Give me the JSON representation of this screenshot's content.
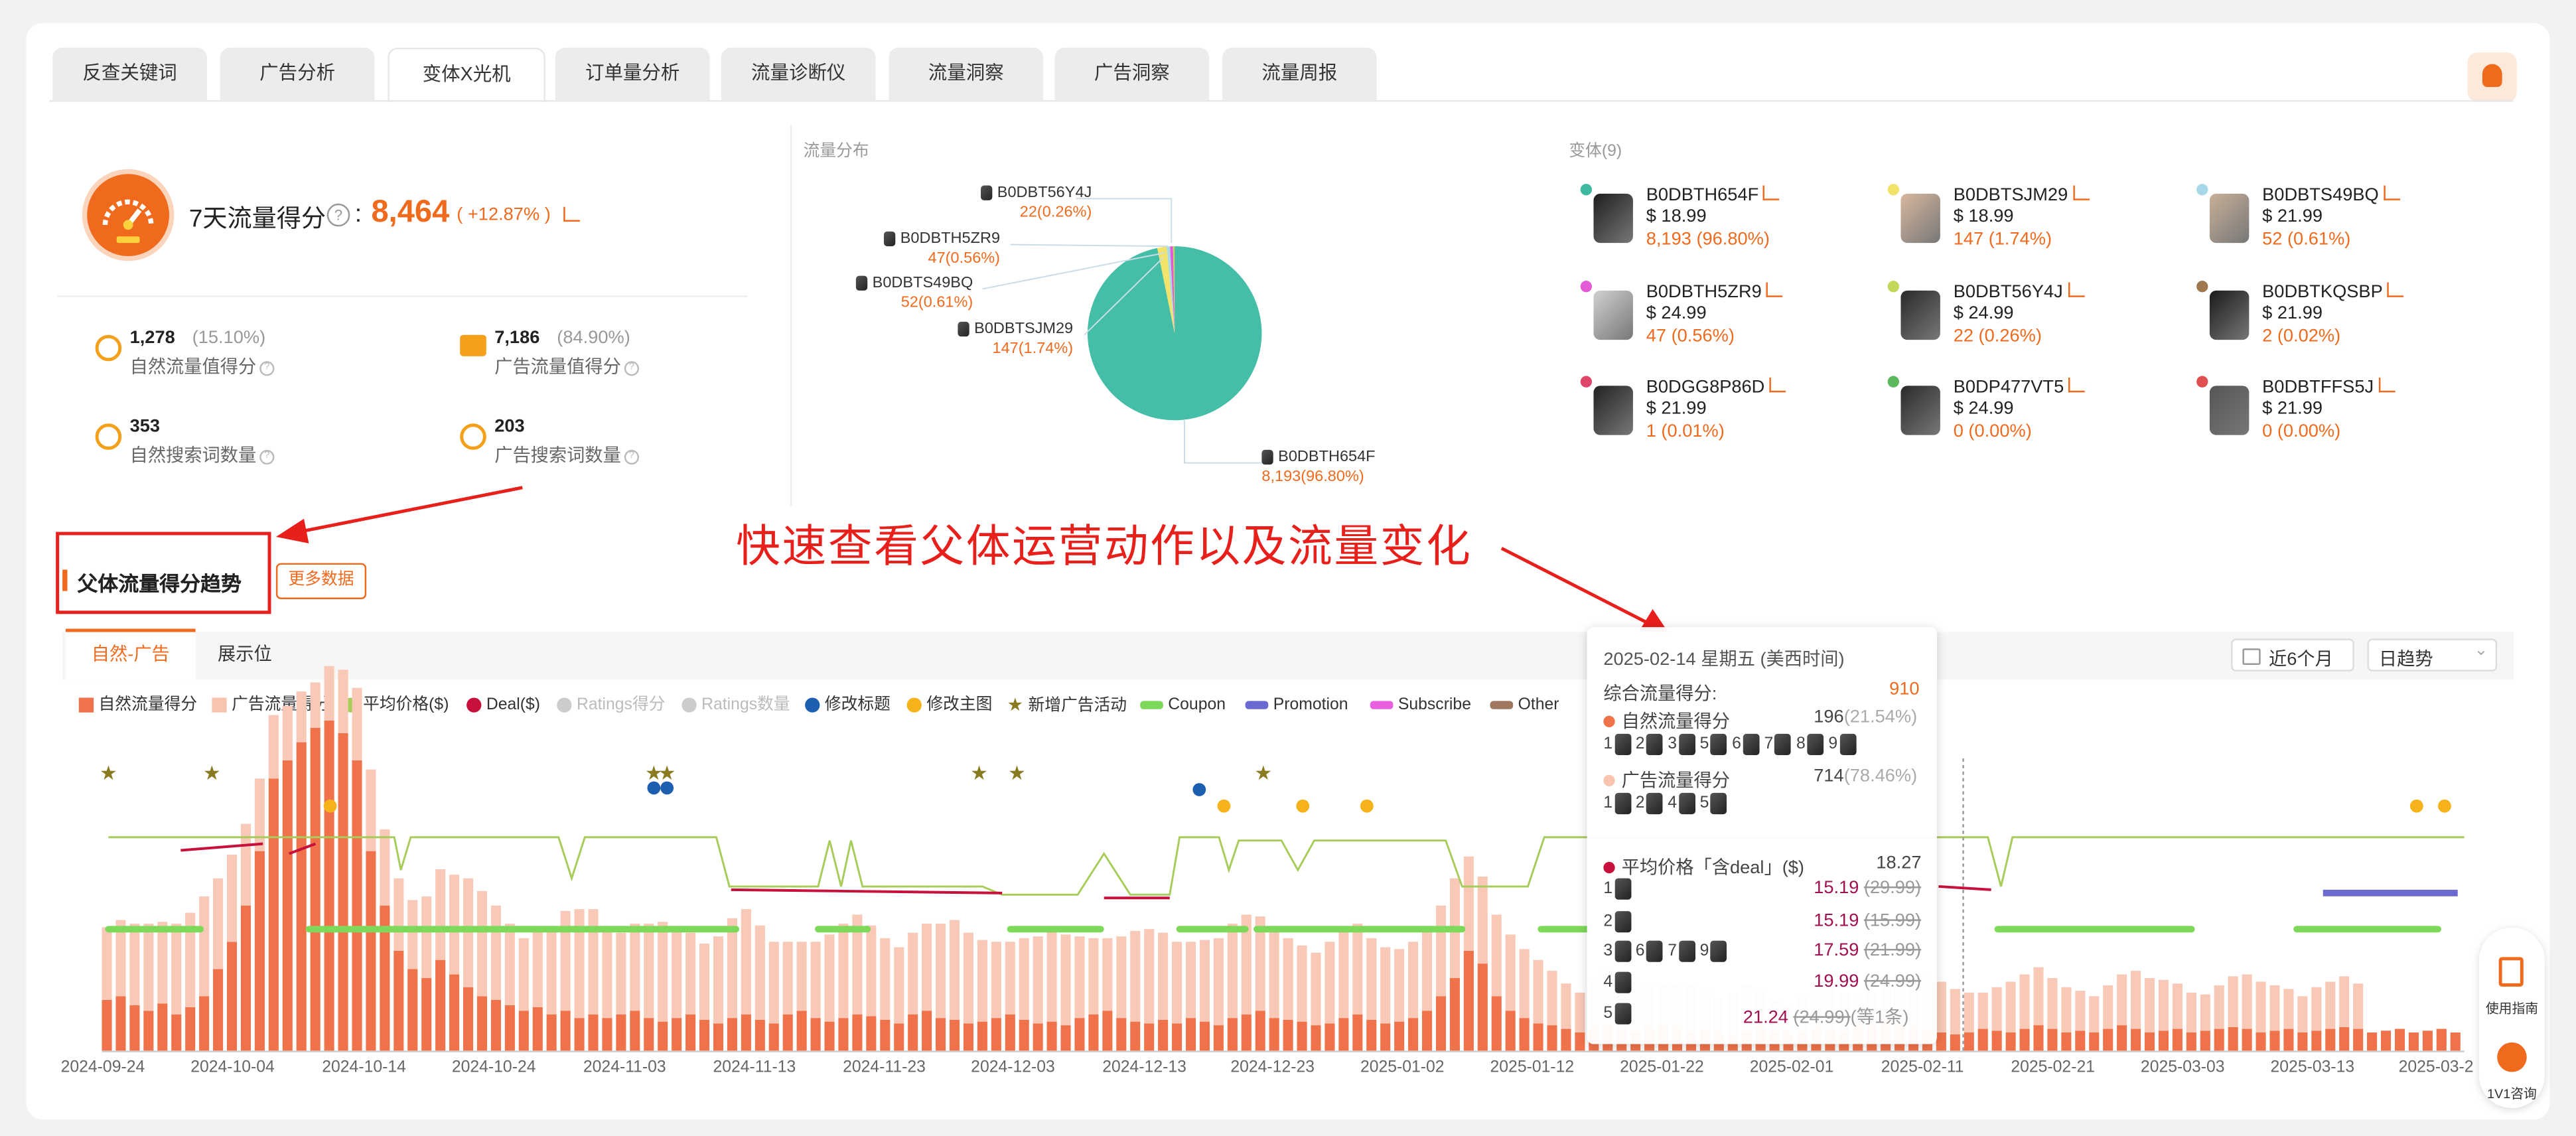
{
  "tabs": [
    "反查关键词",
    "广告分析",
    "变体X光机",
    "订单量分析",
    "流量诊断仪",
    "流量洞察",
    "广告洞察",
    "流量周报"
  ],
  "active_tab": "变体X光机",
  "score": {
    "label": "7天流量得分",
    "value": "8,464",
    "change": "( +12.87% )"
  },
  "metrics": [
    {
      "value": "1,278",
      "pct": "(15.10%)",
      "label": "自然流量值得分",
      "icon": "drop-icon"
    },
    {
      "value": "7,186",
      "pct": "(84.90%)",
      "label": "广告流量值得分",
      "icon": "ad-icon"
    },
    {
      "value": "353",
      "pct": "",
      "label": "自然搜索词数量",
      "icon": "search-circle-icon"
    },
    {
      "value": "203",
      "pct": "",
      "label": "广告搜索词数量",
      "icon": "ad-search-icon"
    }
  ],
  "pie": {
    "title": "流量分布",
    "labels": [
      {
        "name": "B0DBT56Y4J",
        "value": "22(0.26%)"
      },
      {
        "name": "B0DBTH5ZR9",
        "value": "47(0.56%)"
      },
      {
        "name": "B0DBTS49BQ",
        "value": "52(0.61%)"
      },
      {
        "name": "B0DBTSJM29",
        "value": "147(1.74%)"
      },
      {
        "name": "B0DBTH654F",
        "value": "8,193(96.80%)"
      }
    ]
  },
  "variants": {
    "title": "变体(9)",
    "items": [
      {
        "asin": "B0DBTH654F",
        "price": "$ 18.99",
        "stat": "8,193 (96.80%)",
        "color": "#3fb8a0"
      },
      {
        "asin": "B0DBTSJM29",
        "price": "$ 18.99",
        "stat": "147 (1.74%)",
        "color": "#f2e26a"
      },
      {
        "asin": "B0DBTS49BQ",
        "price": "$ 21.99",
        "stat": "52 (0.61%)",
        "color": "#a6d8e8"
      },
      {
        "asin": "B0DBTH5ZR9",
        "price": "$ 24.99",
        "stat": "47 (0.56%)",
        "color": "#e35bd6"
      },
      {
        "asin": "B0DBT56Y4J",
        "price": "$ 24.99",
        "stat": "22 (0.26%)",
        "color": "#c2d85a"
      },
      {
        "asin": "B0DBTKQSBP",
        "price": "$ 21.99",
        "stat": "2 (0.02%)",
        "color": "#a07850"
      },
      {
        "asin": "B0DGG8P86D",
        "price": "$ 21.99",
        "stat": "1 (0.01%)",
        "color": "#e0456a"
      },
      {
        "asin": "B0DP477VT5",
        "price": "$ 24.99",
        "stat": "0 (0.00%)",
        "color": "#5cb85c"
      },
      {
        "asin": "B0DBTFFS5J",
        "price": "$ 21.99",
        "stat": "0 (0.00%)",
        "color": "#e05050"
      }
    ]
  },
  "annotation": "快速查看父体运营动作以及流量变化",
  "section": {
    "title": "父体流量得分趋势",
    "more": "更多数据"
  },
  "subtabs": [
    "自然-广告",
    "展示位"
  ],
  "range": {
    "period": "近6个月",
    "granularity": "日趋势"
  },
  "legend": [
    {
      "label": "自然流量得分",
      "color": "#f0724a",
      "shape": "rect"
    },
    {
      "label": "广告流量得分",
      "color": "#f8c4b0",
      "shape": "rect"
    },
    {
      "label": "平均价格($)",
      "color": "#a8cc5a",
      "shape": "dot"
    },
    {
      "label": "Deal($)",
      "color": "#c8103c",
      "shape": "dot"
    },
    {
      "label": "Ratings得分",
      "color": "#cccccc",
      "shape": "dot"
    },
    {
      "label": "Ratings数量",
      "color": "#cccccc",
      "shape": "dot"
    },
    {
      "label": "修改标题",
      "color": "#1c5fb0",
      "shape": "dot"
    },
    {
      "label": "修改主图",
      "color": "#f5b21a",
      "shape": "dot"
    },
    {
      "label": "新增广告活动",
      "color": "#8a7a20",
      "shape": "star"
    },
    {
      "label": "Coupon",
      "color": "#7ed85a",
      "shape": "bar"
    },
    {
      "label": "Promotion",
      "color": "#6a6ad0",
      "shape": "bar"
    },
    {
      "label": "Subscribe",
      "color": "#e860e0",
      "shape": "bar"
    },
    {
      "label": "Other",
      "color": "#a07860",
      "shape": "bar"
    }
  ],
  "x_labels": [
    "2024-09-24",
    "2024-10-04",
    "2024-10-14",
    "2024-10-24",
    "2024-11-03",
    "2024-11-13",
    "2024-11-23",
    "2024-12-03",
    "2024-12-13",
    "2024-12-23",
    "2025-01-02",
    "2025-01-12",
    "2025-01-22",
    "2025-02-01",
    "2025-02-11",
    "2025-02-21",
    "2025-03-03",
    "2025-03-13",
    "2025-03-2"
  ],
  "tooltip": {
    "date": "2025-02-14 星期五 (美西时间)",
    "total_label": "综合流量得分:",
    "total_value": "910",
    "organic_label": "自然流量得分",
    "organic_value": "196",
    "organic_pct": "(21.54%)",
    "organic_nums": [
      "1",
      "2",
      "3",
      "5",
      "6",
      "7",
      "8",
      "9"
    ],
    "ad_label": "广告流量得分",
    "ad_value": "714",
    "ad_pct": "(78.46%)",
    "ad_nums": [
      "1",
      "2",
      "4",
      "5"
    ],
    "price_label": "平均价格「含deal」($)",
    "price_value": "18.27",
    "prices": [
      {
        "idx": "1",
        "nums": [],
        "deal": "15.19",
        "orig": "(29.99)",
        "extra": ""
      },
      {
        "idx": "2",
        "nums": [],
        "deal": "15.19",
        "orig": "(15.99)",
        "extra": ""
      },
      {
        "idx": "3",
        "nums": [
          "6",
          "7",
          "9"
        ],
        "deal": "17.59",
        "orig": "(21.99)",
        "extra": ""
      },
      {
        "idx": "4",
        "nums": [],
        "deal": "19.99",
        "orig": "(24.99)",
        "extra": ""
      },
      {
        "idx": "5",
        "nums": [],
        "deal": "21.24",
        "orig": "(24.99)",
        "extra": "(等1条)"
      }
    ]
  },
  "side_buttons": [
    {
      "label": "使用指南"
    },
    {
      "label": "1V1咨询"
    }
  ],
  "chart_data": {
    "type": "bar",
    "title": "父体流量得分趋势",
    "x_range": [
      "2024-09-24",
      "2025-03-2"
    ],
    "series": [
      {
        "name": "自然流量得分",
        "values": [
          28,
          30,
          25,
          22,
          26,
          20,
          24,
          30,
          45,
          60,
          80,
          110,
          150,
          160,
          170,
          178,
          182,
          175,
          160,
          110,
          80,
          55,
          45,
          40,
          50,
          42,
          35,
          30,
          28,
          25,
          22,
          24,
          20,
          22,
          18,
          20,
          18,
          20,
          22,
          18,
          16,
          18,
          20,
          17,
          15,
          18,
          20,
          17,
          15,
          20,
          22,
          18,
          16,
          18,
          20,
          19,
          17,
          15,
          20,
          22,
          18,
          17,
          15,
          16,
          18,
          20,
          17,
          15,
          16,
          14,
          18,
          20,
          22,
          18,
          16,
          15,
          17,
          15,
          18,
          16,
          14,
          18,
          20,
          22,
          18,
          17,
          16,
          14,
          15,
          18,
          20,
          17,
          15,
          16,
          18,
          22,
          30,
          40,
          55,
          48,
          30,
          22,
          18,
          15,
          14,
          12,
          10,
          12,
          14,
          11,
          10,
          12,
          14,
          12,
          10,
          11,
          9,
          8,
          10,
          12,
          10,
          9,
          10,
          12,
          11,
          10,
          12,
          14,
          16,
          14,
          12,
          11,
          10,
          9,
          10,
          12,
          11,
          10,
          12,
          14,
          12,
          10,
          11,
          10,
          12,
          14,
          12,
          10,
          11,
          12,
          10,
          11,
          12,
          13,
          12,
          10,
          11,
          12,
          10,
          11,
          12,
          13,
          12,
          10,
          11,
          12,
          10,
          11,
          12,
          10
        ]
      },
      {
        "name": "广告流量得分",
        "values": [
          40,
          42,
          45,
          48,
          45,
          50,
          52,
          55,
          50,
          48,
          45,
          40,
          35,
          30,
          28,
          25,
          30,
          35,
          40,
          45,
          42,
          40,
          38,
          45,
          50,
          55,
          60,
          58,
          52,
          45,
          40,
          42,
          48,
          55,
          60,
          58,
          50,
          45,
          48,
          52,
          55,
          50,
          45,
          42,
          48,
          55,
          58,
          52,
          45,
          40,
          38,
          42,
          48,
          52,
          55,
          50,
          45,
          42,
          45,
          48,
          52,
          55,
          50,
          45,
          42,
          40,
          45,
          48,
          52,
          50,
          45,
          42,
          40,
          45,
          50,
          52,
          48,
          45,
          42,
          45,
          48,
          52,
          55,
          52,
          48,
          45,
          42,
          40,
          45,
          48,
          50,
          45,
          42,
          40,
          42,
          45,
          50,
          55,
          52,
          48,
          45,
          42,
          38,
          35,
          30,
          25,
          22,
          28,
          32,
          30,
          28,
          25,
          22,
          24,
          26,
          22,
          20,
          24,
          26,
          22,
          18,
          16,
          20,
          22,
          24,
          22,
          20,
          18,
          22,
          25,
          28,
          30,
          28,
          25,
          22,
          20,
          24,
          28,
          30,
          32,
          28,
          25,
          22,
          20,
          24,
          28,
          32,
          30,
          28,
          25,
          22,
          20,
          24,
          28,
          30,
          28,
          25,
          22,
          20,
          24,
          26,
          28,
          25
        ]
      },
      {
        "name": "平均价格($)",
        "values": [
          20.9,
          20.9,
          20.9,
          20.9,
          20.9,
          20.9,
          20.9,
          20.9,
          20.9,
          20.9,
          20.9,
          20.9,
          20.9,
          20.9,
          20.9,
          20.9,
          20.9,
          20.9,
          20.9,
          20.9,
          20.9,
          20.9,
          20.9,
          20.9,
          20.9,
          20.9,
          20.9,
          20.9,
          20.9,
          20.9,
          20.9,
          20.9,
          20.9,
          20.9,
          20.9,
          20.9,
          20.9,
          20.9,
          20.9,
          20.9,
          20.9,
          20.9,
          20.9,
          20.9,
          20.9,
          20.9,
          20.9,
          20.9,
          20.9,
          20.9,
          20.9,
          20.9,
          20.9,
          20.9,
          20.9,
          20.9,
          20.9,
          20.9,
          20.9,
          20.9,
          20.9,
          20.9,
          20.9,
          20.9,
          20.9,
          20.9,
          20.9,
          20.9,
          20.9,
          20.9,
          20.9,
          20.9,
          20.9,
          20.9,
          20.9,
          20.9,
          20.9,
          20.9,
          20.9,
          20.9,
          20.9,
          20.9,
          20.9,
          20.9,
          20.9,
          20.9,
          20.9,
          20.9,
          20.9,
          20.9,
          20.9,
          20.9,
          20.9,
          20.9,
          20.9,
          20.9,
          20.9,
          20.9,
          20.9,
          20.9,
          20.9,
          20.9,
          20.9,
          20.9,
          20.9,
          20.9,
          20.9,
          20.9,
          20.9,
          20.9,
          20.9,
          20.9,
          20.9,
          20.9,
          20.9,
          20.9,
          20.9,
          20.9,
          20.9,
          20.9,
          20.9,
          20.9,
          20.9,
          20.9,
          20.9,
          20.9,
          20.9,
          20.9,
          20.9,
          20.9,
          20.9,
          20.9,
          20.9,
          20.9,
          20.9,
          20.9,
          20.9,
          20.9,
          20.9,
          20.9,
          20.9,
          20.9,
          20.9,
          20.9,
          20.9,
          20.9,
          20.9,
          20.9,
          20.9,
          20.9,
          20.9,
          20.9,
          20.9,
          20.9,
          20.9,
          20.9,
          20.9,
          20.9,
          20.9
        ]
      }
    ],
    "events": {
      "新增广告活动": [
        "2024-09-24",
        "2024-10-01",
        "2024-11-05",
        "2024-11-06",
        "2024-12-02",
        "2024-12-04",
        "2024-12-22"
      ],
      "修改标题": [
        "2024-11-05",
        "2024-11-06",
        "2024-12-18"
      ],
      "修改主图": [
        "2024-10-11",
        "2024-12-20",
        "2024-12-23",
        "2024-12-29",
        "2025-03-17",
        "2025-03-19"
      ]
    },
    "legend": "top",
    "grid": false
  }
}
